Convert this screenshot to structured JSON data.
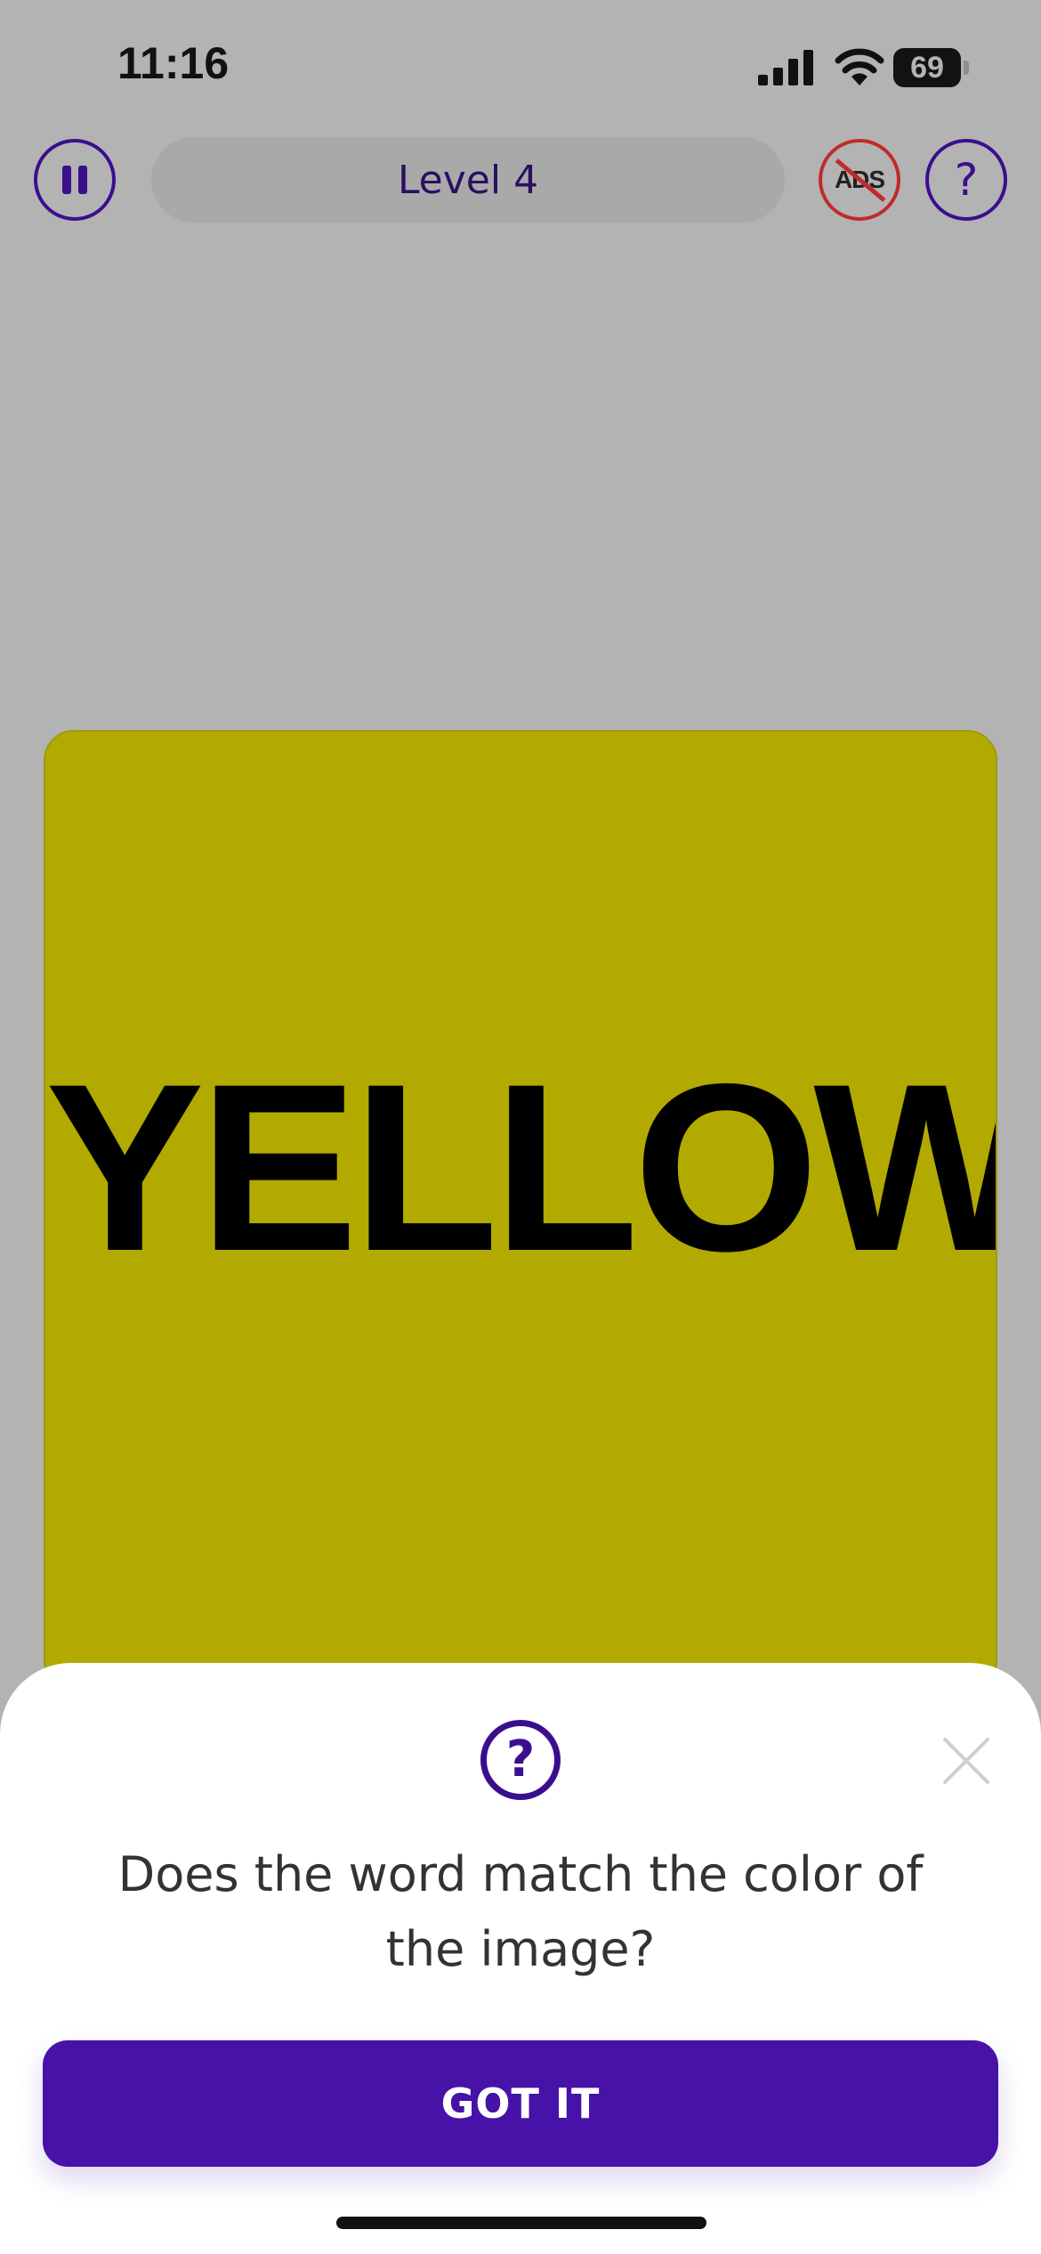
{
  "status_bar": {
    "time": "11:16",
    "battery": "69",
    "icons": [
      "signal-icon",
      "wifi-icon",
      "battery-icon"
    ]
  },
  "top_bar": {
    "pause_icon": "pause-icon",
    "level_label": "Level 4",
    "no_ads_label": "ADS",
    "help_label": "?"
  },
  "card": {
    "word": "YELLOW",
    "background_color": "#b2aa00",
    "text_color": "#000000"
  },
  "hint_sheet": {
    "help_icon": "?",
    "close_icon": "close-icon",
    "message": "Does the word match the color of the image?",
    "button_label": "GOT IT"
  },
  "colors": {
    "accent": "#4612a8",
    "overlay_background": "#b3b3b3",
    "no_ads_red": "#c22a2a"
  }
}
